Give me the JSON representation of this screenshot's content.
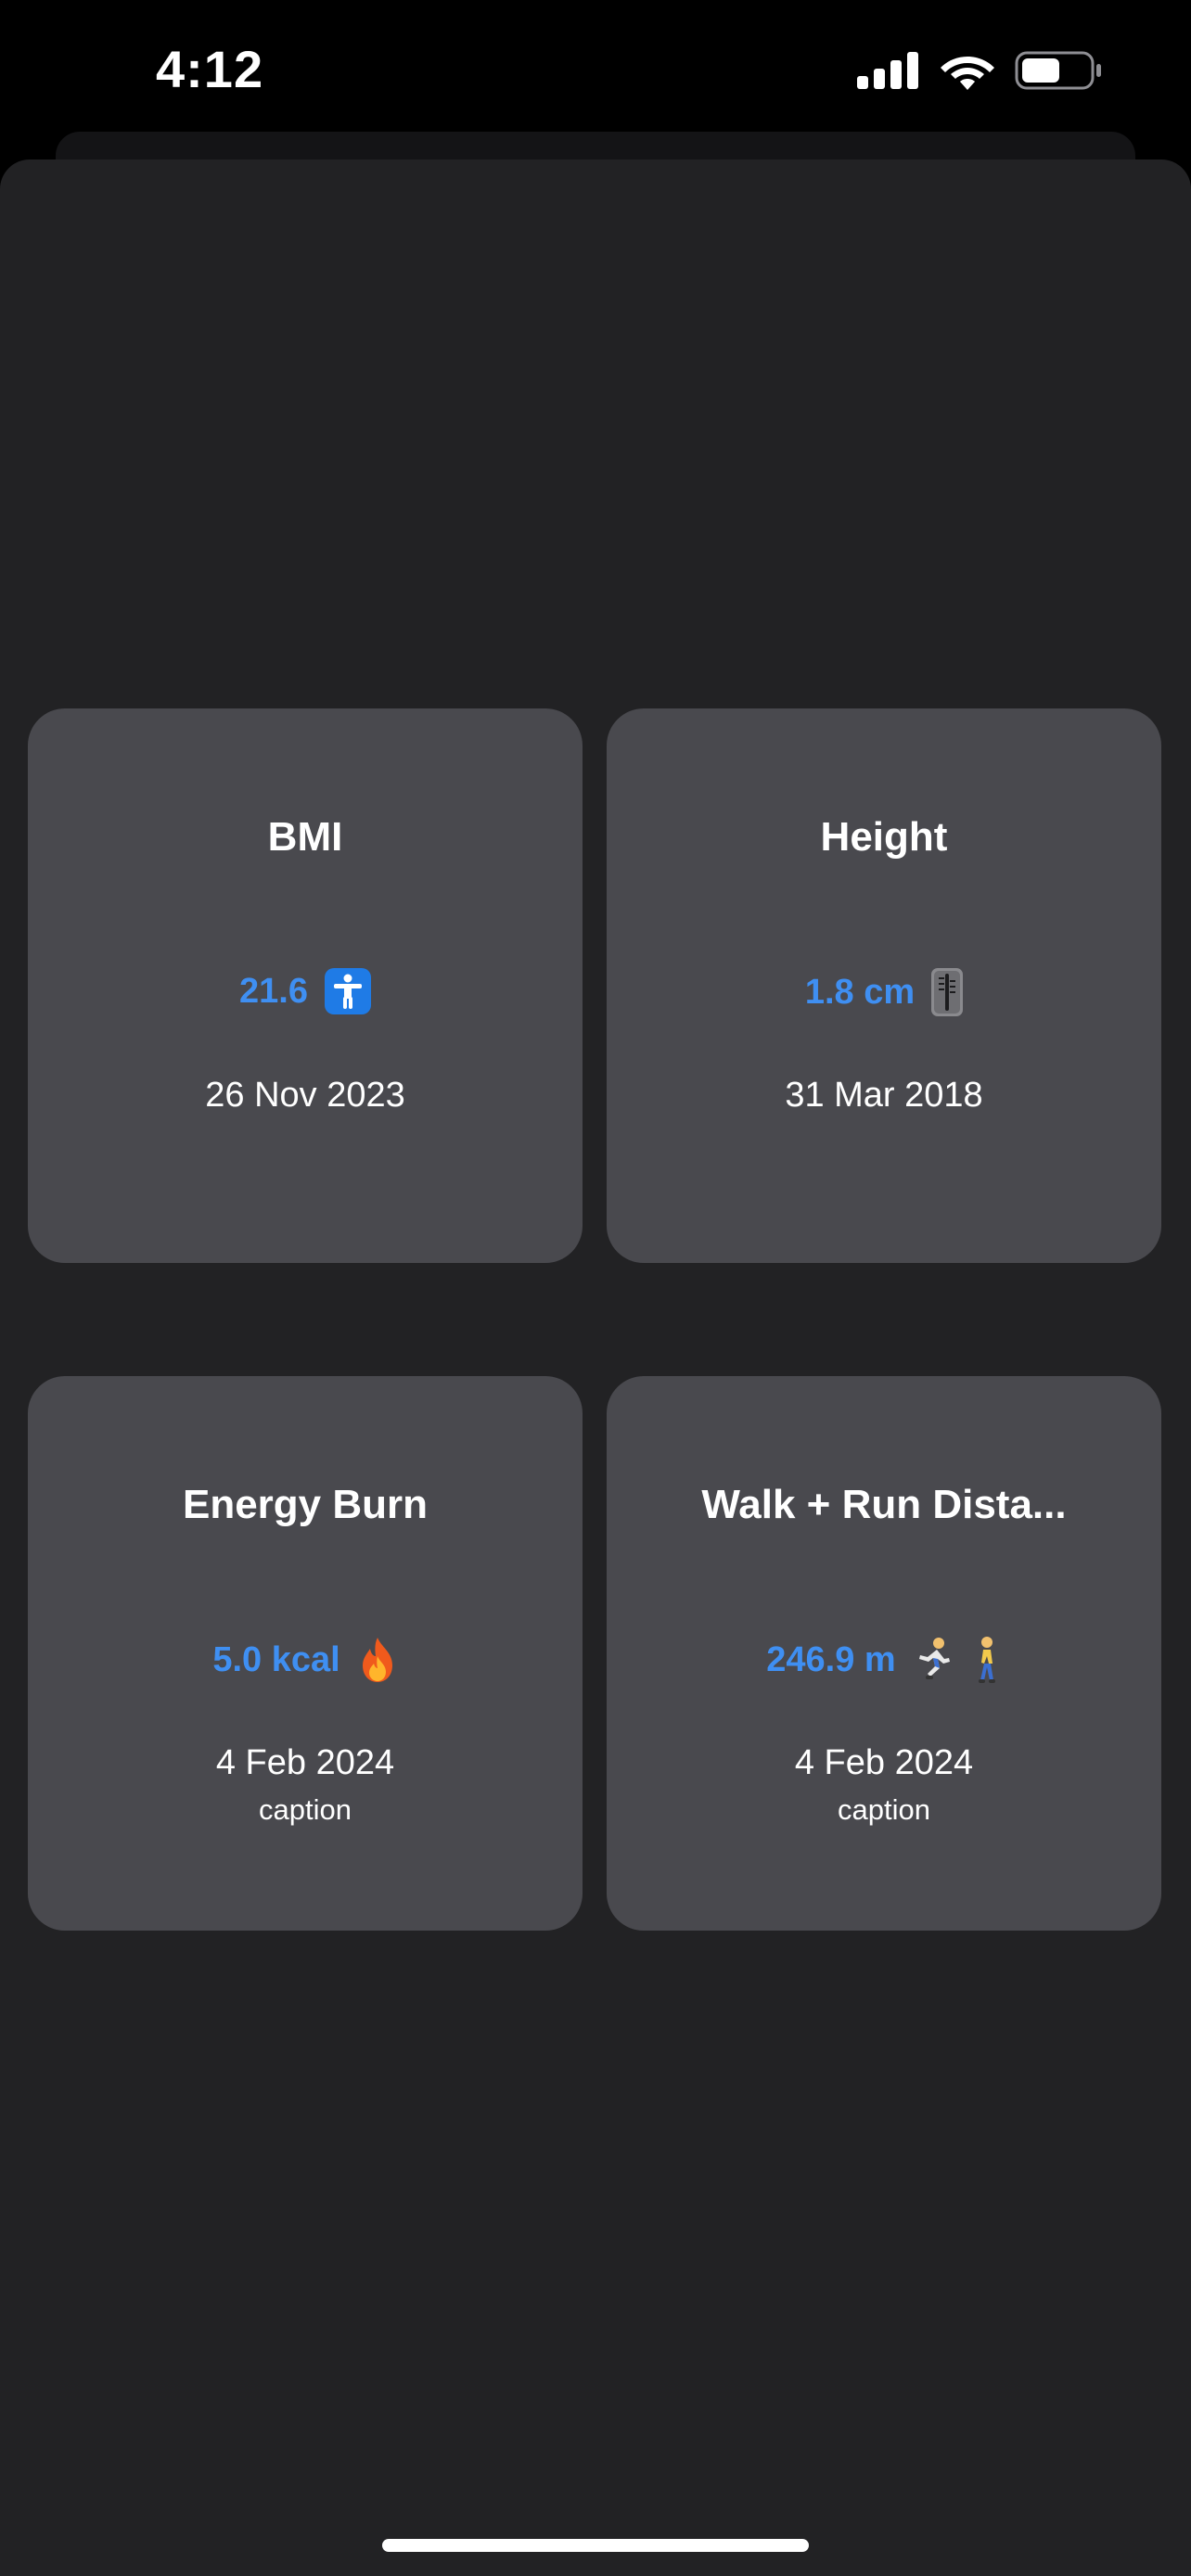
{
  "status_bar": {
    "time": "4:12",
    "icons": [
      "cellular-signal-icon",
      "wifi-icon",
      "battery-icon"
    ]
  },
  "colors": {
    "background": "#222224",
    "card": "#49494e",
    "accent_value": "#3f8ff2",
    "text": "#ffffff"
  },
  "cards": [
    {
      "title": "BMI",
      "value": "21.6",
      "icon": "accessibility-icon",
      "date": "26 Nov 2023",
      "caption": ""
    },
    {
      "title": "Height",
      "value": "1.8 cm",
      "icon": "thermometer-icon",
      "date": "31 Mar 2018",
      "caption": ""
    },
    {
      "title": "Energy Burn",
      "value": "5.0 kcal",
      "icon": "fire-icon",
      "emoji": "🔥",
      "date": "4 Feb 2024",
      "caption": "caption"
    },
    {
      "title": "Walk + Run Dista...",
      "value": "246.9 m",
      "icon": "runner-walker-icon",
      "emoji": "🏃 🚶",
      "date": "4 Feb 2024",
      "caption": "caption"
    }
  ]
}
